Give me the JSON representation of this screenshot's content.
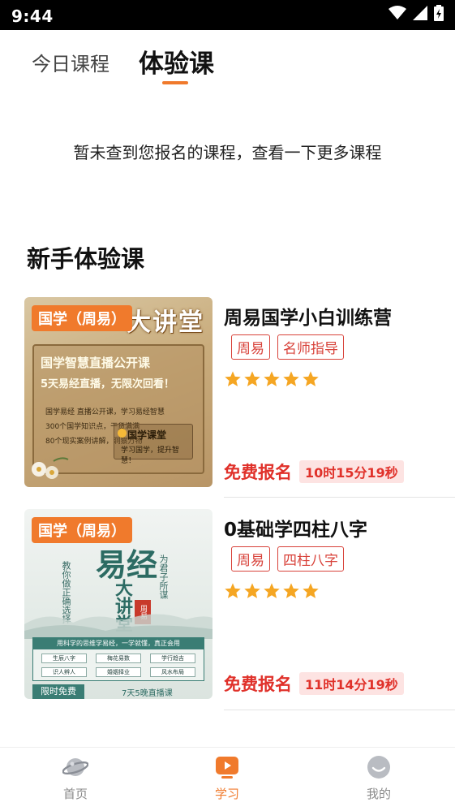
{
  "status_bar": {
    "time": "9:44",
    "icons": [
      "wifi-icon",
      "signal-icon",
      "battery-charging-icon"
    ]
  },
  "tabs": [
    {
      "label": "今日课程",
      "active": false
    },
    {
      "label": "体验课",
      "active": true
    }
  ],
  "accent_color": "#f07a2c",
  "price_color": "#e0312a",
  "empty_message": "暂未查到您报名的课程，查看一下更多课程",
  "section_title": "新手体验课",
  "courses": [
    {
      "title": "周易国学小白训练营",
      "tags": [
        "周易",
        "名师指导"
      ],
      "rating": 5,
      "free_label": "免费报名",
      "countdown": "10时15分19秒",
      "thumbnail": {
        "tag": "国学（周易）",
        "banner": "大讲堂",
        "line1": "国学智慧直播公开课",
        "line2": "5天易经直播，无限次回看！",
        "bullets": [
          "国学易经 直播公开课，学习易经智慧",
          "300个国学知识点，干货满满",
          "80个现实案例讲解，洞察万物"
        ],
        "brand_title": "国学课堂",
        "brand_sub": "学习国学，提升智慧！"
      }
    },
    {
      "title": "0基础学四柱八字",
      "tags": [
        "周易",
        "四柱八字"
      ],
      "rating": 5,
      "free_label": "免费报名",
      "countdown": "11时14分19秒",
      "thumbnail": {
        "tag": "国学（周易）",
        "title": "易经",
        "sub": "大讲堂",
        "seal": "周易",
        "vertical_1": "教你做正确选择",
        "vertical_2": "为君子所谋",
        "box_head": "用科学的思维学易经，一学就懂，真正会用",
        "chips": [
          "生辰八字",
          "梅花易数",
          "学行趋吉",
          "识人辨人",
          "婚姻择业",
          "风水布局"
        ],
        "limited": "限时免费",
        "schedule": "7天5晚直播课"
      }
    }
  ],
  "bottom_nav": [
    {
      "label": "首页",
      "icon": "planet-icon",
      "active": false
    },
    {
      "label": "学习",
      "icon": "play-icon",
      "active": true
    },
    {
      "label": "我的",
      "icon": "user-icon",
      "active": false
    }
  ]
}
